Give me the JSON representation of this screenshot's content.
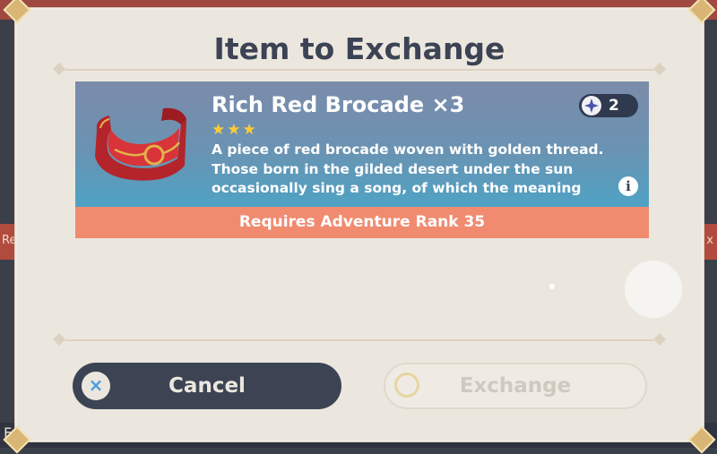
{
  "background": {
    "left_label": "Rec",
    "right_label": "x",
    "bottom_label": "Fa"
  },
  "dialog": {
    "title": "Item to Exchange"
  },
  "item": {
    "name": "Rich Red Brocade ×3",
    "stars": "★★★",
    "rarity": 3,
    "description": "A piece of red brocade woven with golden thread. Those born in the gilded desert under the sun occasionally sing a song, of which the meaning",
    "owned_count": "2",
    "image_icon": "red-brocade-icon",
    "info_symbol": "i"
  },
  "requirement": {
    "text": "Requires Adventure Rank 35"
  },
  "buttons": {
    "cancel_label": "Cancel",
    "cancel_icon": "×",
    "exchange_label": "Exchange"
  },
  "colors": {
    "dialog_bg": "#ece7de",
    "title_text": "#3b4354",
    "requirement_bg": "#f08b70",
    "star": "#ffcc32",
    "cancel_bg": "#3c4454",
    "cancel_icon": "#4a9de0"
  }
}
